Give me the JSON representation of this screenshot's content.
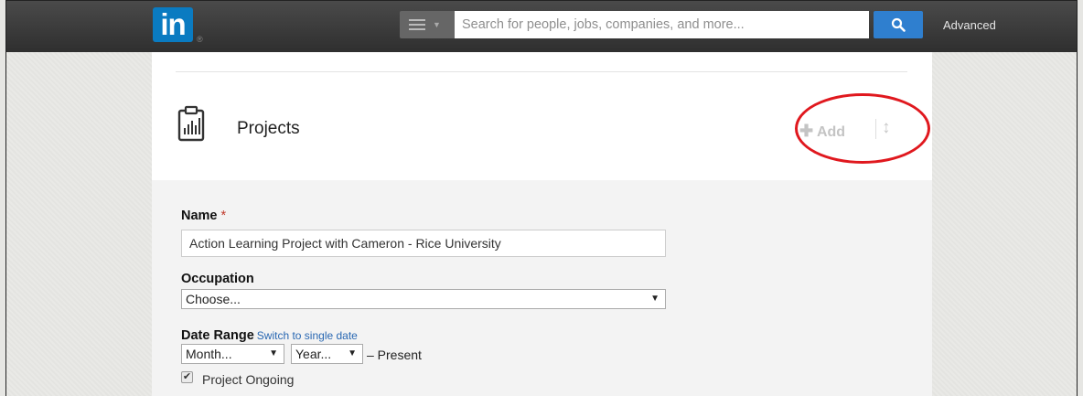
{
  "header": {
    "logo_text": "in",
    "logo_reg": "®",
    "search_placeholder": "Search for people, jobs, companies, and more...",
    "advanced_label": "Advanced",
    "brand_color": "#0a7bc1",
    "search_button_color": "#2f7fcf"
  },
  "section": {
    "title": "Projects",
    "add_label": "Add",
    "add_icon": "plus-icon",
    "reorder_icon": "reorder-icon",
    "annotation_color": "#e0181e"
  },
  "form": {
    "name_label": "Name",
    "required_mark": "*",
    "name_value": "Action Learning Project with Cameron - Rice University",
    "occupation_label": "Occupation",
    "occupation_value": "Choose...",
    "date_range_label": "Date Range",
    "switch_link": "Switch to single date",
    "month_value": "Month...",
    "year_value": "Year...",
    "present_text": "– Present",
    "ongoing_label": "Project Ongoing",
    "ongoing_checked": true
  }
}
